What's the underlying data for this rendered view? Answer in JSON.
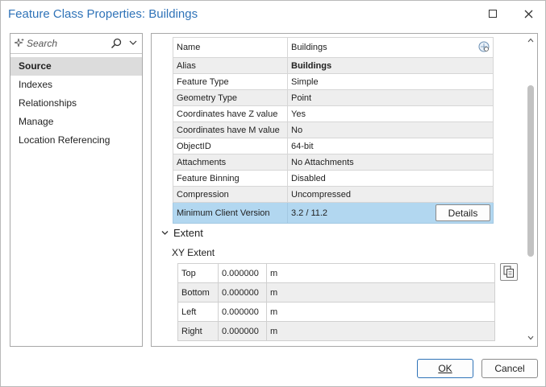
{
  "window": {
    "title": "Feature Class Properties: Buildings"
  },
  "search": {
    "placeholder": "Search"
  },
  "nav": {
    "items": [
      {
        "label": "Source"
      },
      {
        "label": "Indexes"
      },
      {
        "label": "Relationships"
      },
      {
        "label": "Manage"
      },
      {
        "label": "Location Referencing"
      }
    ],
    "selected": "Source"
  },
  "properties": [
    {
      "key": "Name",
      "value": "Buildings"
    },
    {
      "key": "Alias",
      "value": "Buildings"
    },
    {
      "key": "Feature Type",
      "value": "Simple"
    },
    {
      "key": "Geometry Type",
      "value": "Point"
    },
    {
      "key": "Coordinates have Z value",
      "value": "Yes"
    },
    {
      "key": "Coordinates have M value",
      "value": "No"
    },
    {
      "key": "ObjectID",
      "value": "64-bit"
    },
    {
      "key": "Attachments",
      "value": "No Attachments"
    },
    {
      "key": "Feature Binning",
      "value": "Disabled"
    },
    {
      "key": "Compression",
      "value": "Uncompressed"
    },
    {
      "key": "Minimum Client Version",
      "value": "3.2 / 11.2"
    }
  ],
  "details_button": "Details",
  "extent": {
    "header": "Extent",
    "xy_label": "XY Extent",
    "rows": [
      {
        "label": "Top",
        "value": "0.000000",
        "unit": "m"
      },
      {
        "label": "Bottom",
        "value": "0.000000",
        "unit": "m"
      },
      {
        "label": "Left",
        "value": "0.000000",
        "unit": "m"
      },
      {
        "label": "Right",
        "value": "0.000000",
        "unit": "m"
      }
    ]
  },
  "footer": {
    "ok": "OK",
    "cancel": "Cancel"
  },
  "colors": {
    "title": "#2f73b8",
    "selected_row": "#b2d7f0",
    "nav_selected": "#dcdcdc"
  }
}
